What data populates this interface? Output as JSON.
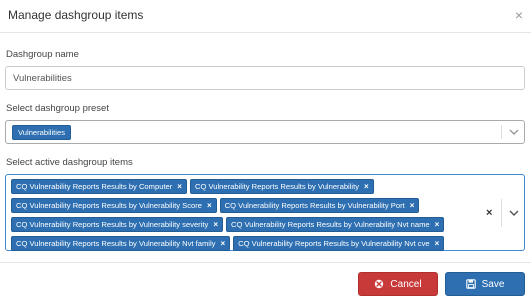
{
  "modal": {
    "title": "Manage dashgroup items",
    "close_glyph": "×"
  },
  "form": {
    "name_label": "Dashgroup name",
    "name_value": "Vulnerabilities",
    "preset_label": "Select dashgroup preset",
    "preset_selected": "Vulnerabilities",
    "items_label": "Select active dashgroup items",
    "clear_glyph": "×",
    "chip_remove_glyph": "×",
    "items": [
      "CQ Vulnerability Reports Results by Computer",
      "CQ Vulnerability Reports Results by Vulnerability",
      "CQ Vulnerability Reports Results by Vulnerability Score",
      "CQ Vulnerability Reports Results by Vulnerability Port",
      "CQ Vulnerability Reports Results by Vulnerability severity",
      "CQ Vulnerability Reports Results by Vulnerability Nvt name",
      "CQ Vulnerability Reports Results by Vulnerability Nvt family",
      "CQ Vulnerability Reports Results by Vulnerability Nvt cve"
    ]
  },
  "footer": {
    "cancel_label": "Cancel",
    "save_label": "Save"
  },
  "icons": {
    "close": "close-icon",
    "chevron": "chevron-down-icon",
    "cancel": "ban-icon",
    "save": "floppy-disk-icon"
  },
  "colors": {
    "accent": "#2d6fb1",
    "danger": "#c83a3a",
    "focus_border": "#3e89d0"
  }
}
